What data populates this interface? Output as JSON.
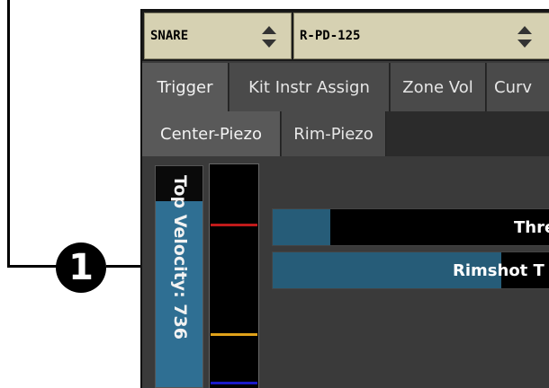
{
  "callout": {
    "number": "1"
  },
  "selectors": {
    "instrument": "SNARE",
    "pad_model": "R-PD-125"
  },
  "tabs": [
    {
      "label": "Trigger",
      "active": true
    },
    {
      "label": "Kit Instr Assign",
      "active": false
    },
    {
      "label": "Zone Vol",
      "active": false
    },
    {
      "label": "Curv",
      "active": false
    }
  ],
  "subtabs": [
    {
      "label": "Center-Piezo",
      "active": true
    },
    {
      "label": "Rim-Piezo",
      "active": false
    }
  ],
  "velocity_panel": {
    "text": "Top Velocity: 736",
    "fill_fraction": 0.84
  },
  "meter": {
    "markers": [
      {
        "name": "red",
        "color": "#c01a1a"
      },
      {
        "name": "yellow",
        "color": "#e0a21a"
      },
      {
        "name": "blue",
        "color": "#1a1ac8"
      }
    ]
  },
  "sliders": {
    "threshold": {
      "label": "Thre",
      "fill_fraction": 0.2
    },
    "rimshot": {
      "label": "Rimshot T",
      "fill_fraction": 0.8
    }
  },
  "colors": {
    "selector_bg": "#d6d1b2",
    "accent_blue": "#2f6f93",
    "tab_active": "#595959"
  }
}
